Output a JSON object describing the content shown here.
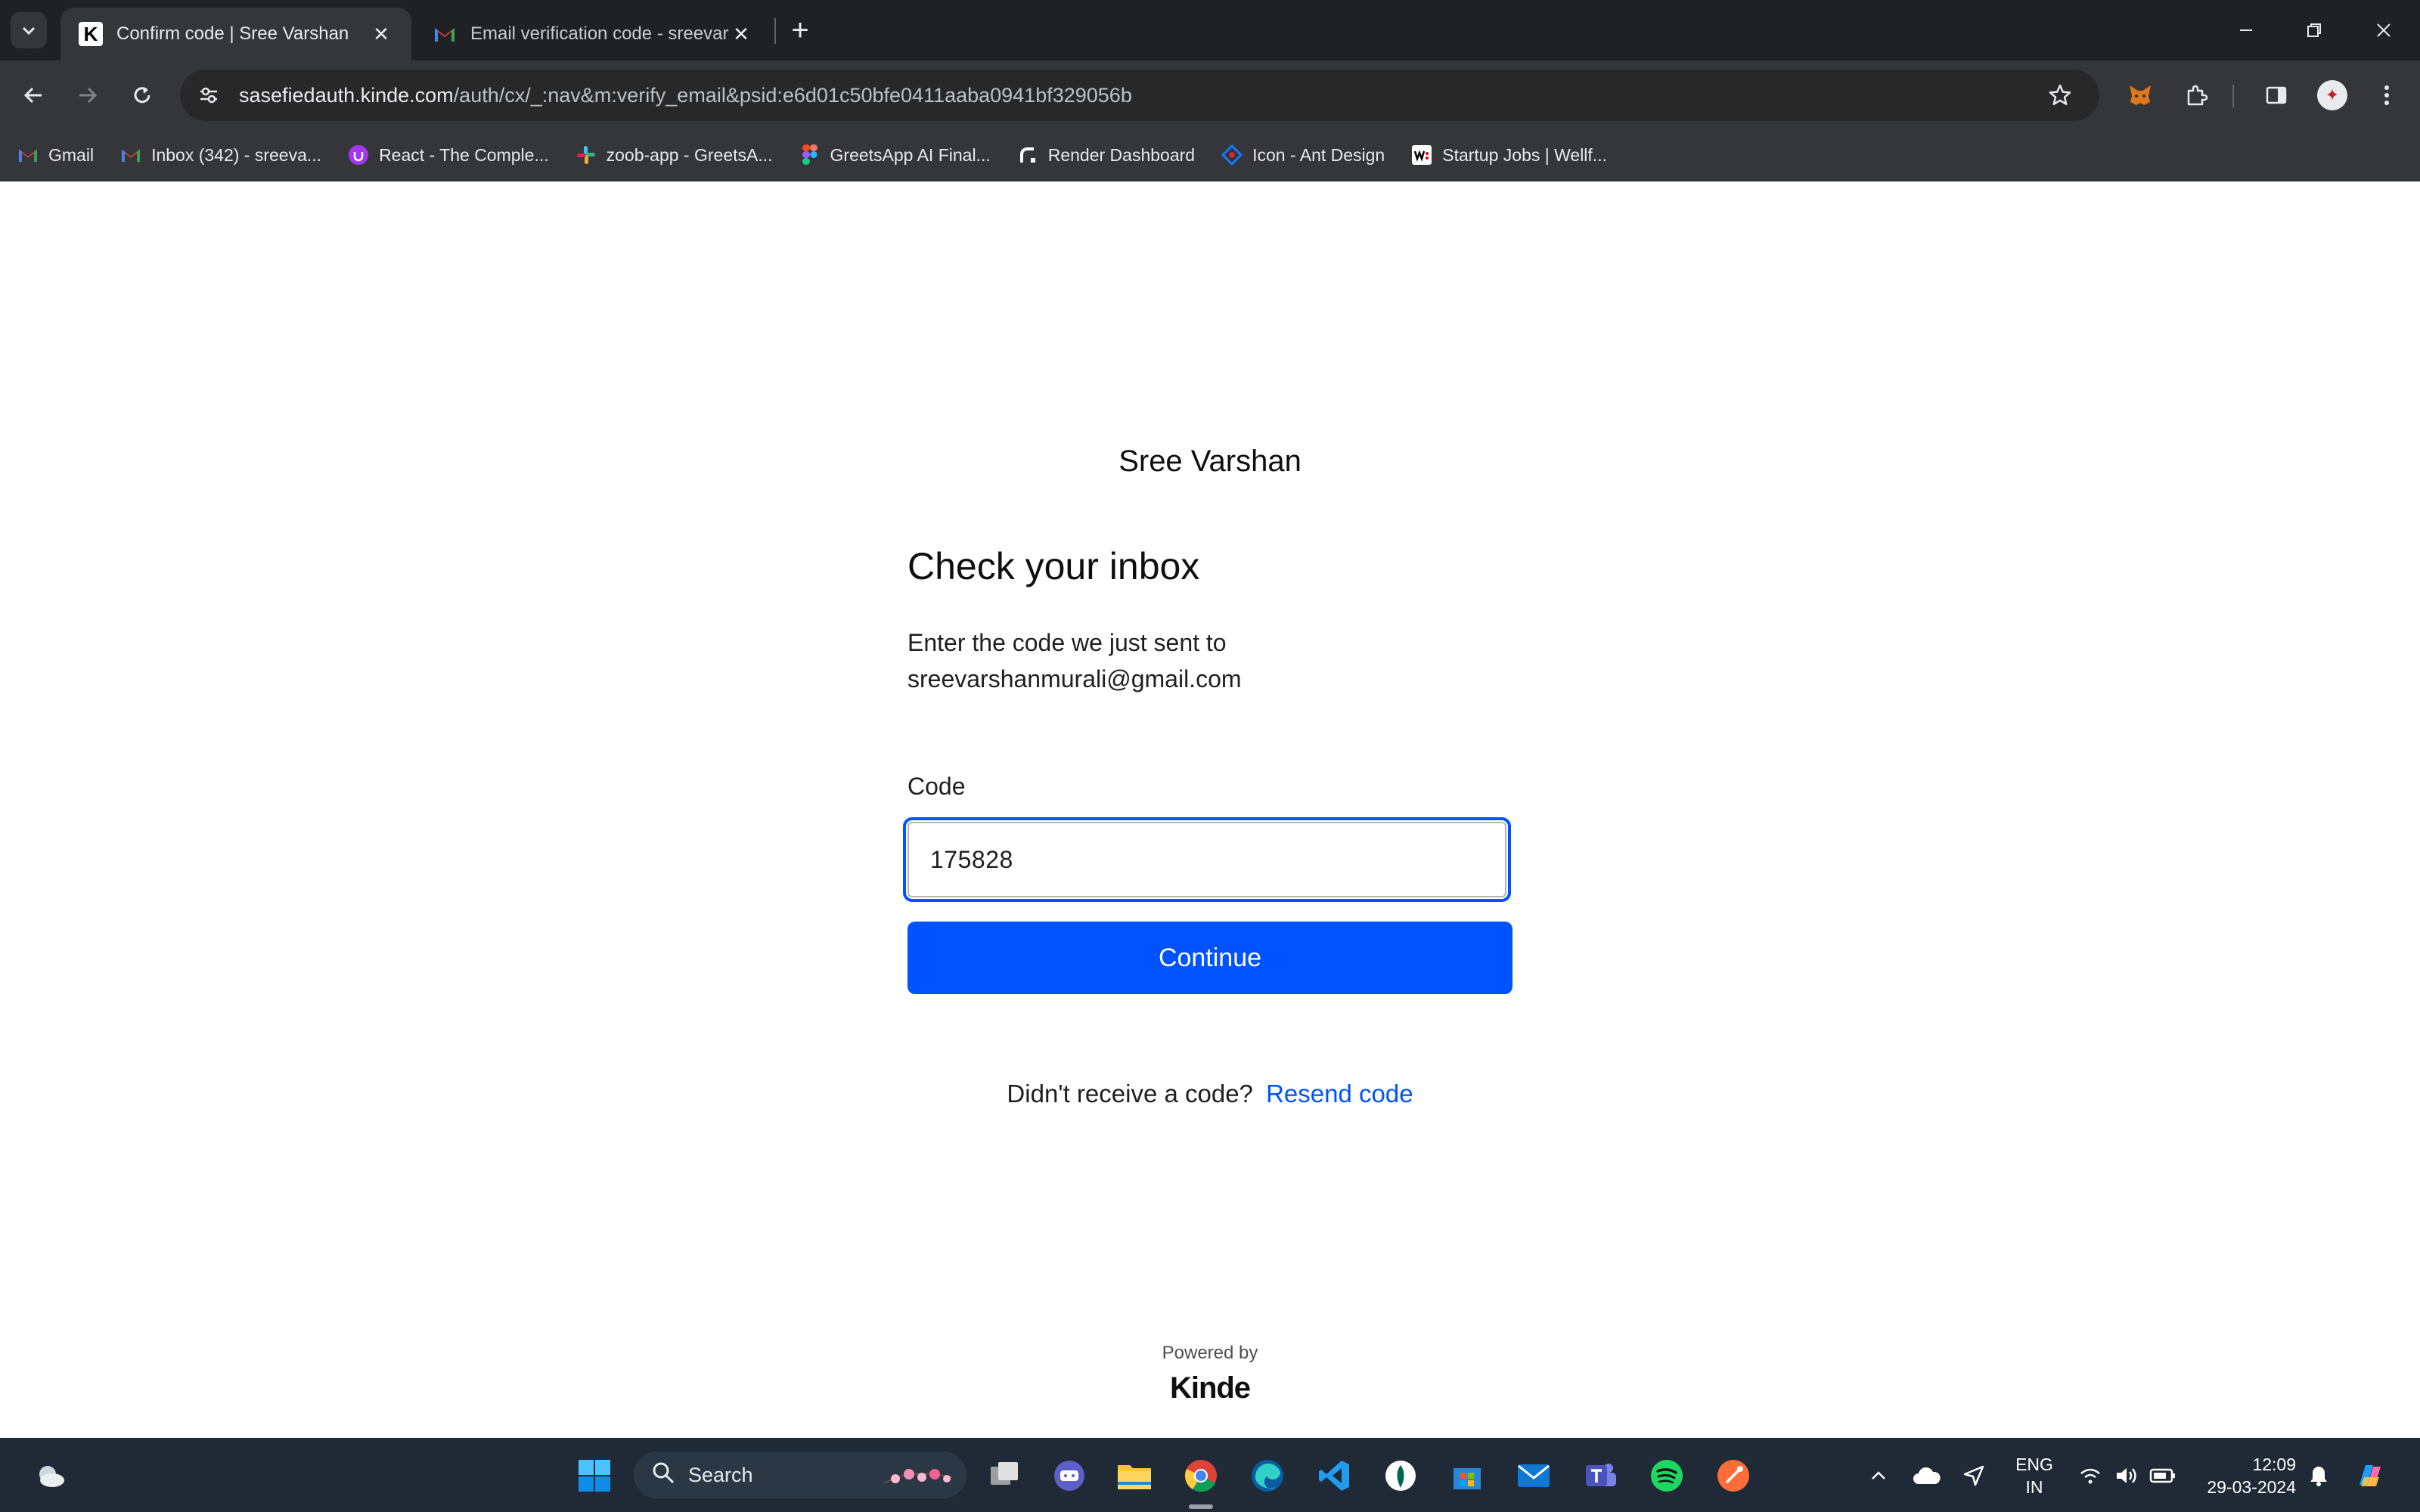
{
  "browser": {
    "tabs": [
      {
        "title": "Confirm code | Sree Varshan",
        "favicon": "kinde-k-icon",
        "active": true
      },
      {
        "title": "Email verification code - sreevar",
        "favicon": "gmail-icon",
        "active": false
      }
    ],
    "address": {
      "host": "sasefiedauth.kinde.com",
      "path": "/auth/cx/_:nav&m:verify_email&psid:e6d01c50bfe0411aaba0941bf329056b"
    },
    "bookmarks": [
      {
        "label": "Gmail",
        "icon": "gmail-icon"
      },
      {
        "label": "Inbox (342) - sreeva...",
        "icon": "gmail-icon"
      },
      {
        "label": "React - The Comple...",
        "icon": "udemy-icon"
      },
      {
        "label": "zoob-app - GreetsA...",
        "icon": "slack-icon"
      },
      {
        "label": "GreetsApp AI Final...",
        "icon": "figma-icon"
      },
      {
        "label": "Render Dashboard",
        "icon": "render-icon"
      },
      {
        "label": "Icon - Ant Design",
        "icon": "ant-design-icon"
      },
      {
        "label": "Startup Jobs | Wellf...",
        "icon": "wellfound-icon"
      }
    ],
    "colors": {
      "chrome_dark": "#202124",
      "toolbar": "#35363a"
    }
  },
  "page": {
    "brand": "Sree Varshan",
    "heading": "Check your inbox",
    "description_line1": "Enter the code we just sent to",
    "description_line2": "sreevarshanmurali@gmail.com",
    "code_label": "Code",
    "code_value": "175828",
    "continue_label": "Continue",
    "resend_prompt": "Didn't receive a code?",
    "resend_link": "Resend code",
    "powered_by": "Powered by",
    "powered_brand": "Kinde",
    "colors": {
      "accent": "#0053ff",
      "text": "#0f0f0f"
    }
  },
  "taskbar": {
    "search_placeholder": "Search",
    "language_line1": "ENG",
    "language_line2": "IN",
    "time": "12:09",
    "date": "29-03-2024",
    "apps": [
      "start-icon",
      "search-icon",
      "task-view-icon",
      "teams-chat-icon",
      "file-explorer-icon",
      "chrome-icon",
      "edge-icon",
      "vscode-icon",
      "mongodb-compass-icon",
      "microsoft-store-icon",
      "mail-icon",
      "teams-icon",
      "spotify-icon",
      "postman-icon"
    ]
  }
}
